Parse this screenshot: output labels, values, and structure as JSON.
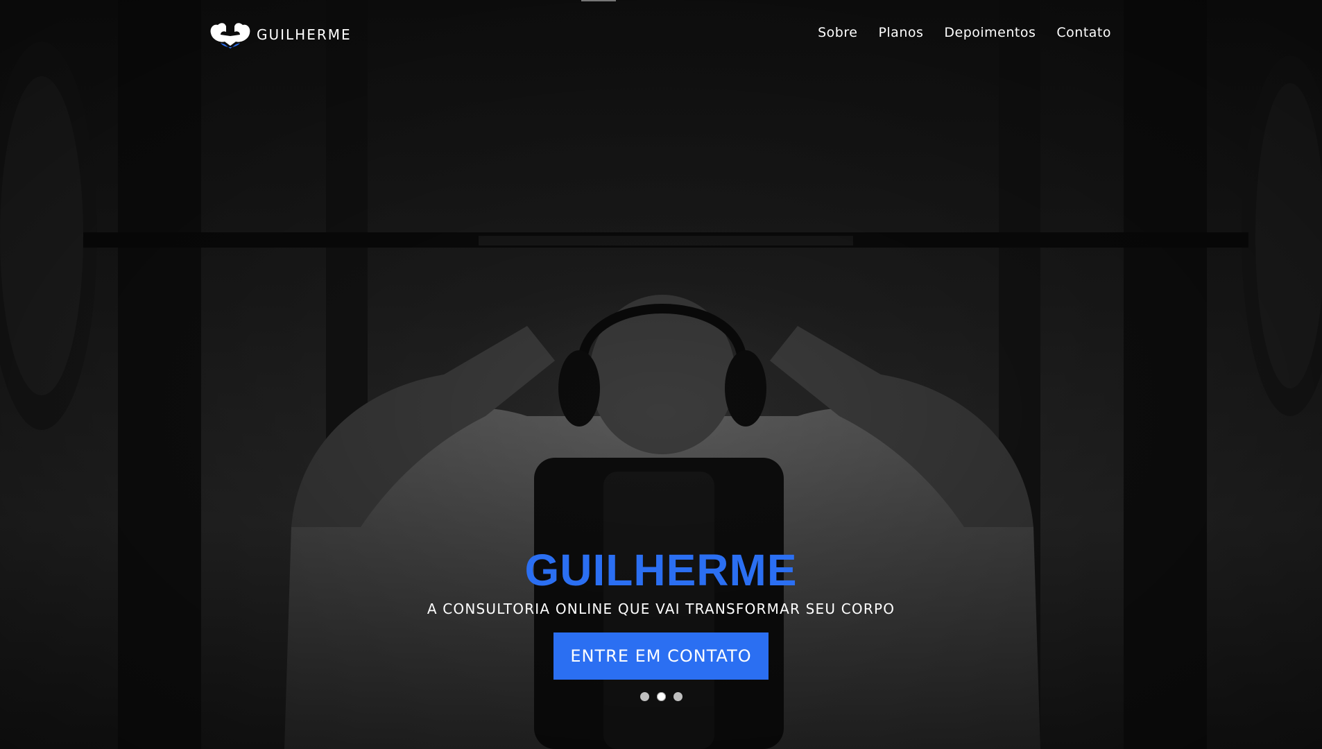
{
  "brand": {
    "name": "GUILHERME",
    "logo_icon": "flexing-arms-icon"
  },
  "nav": {
    "items": [
      {
        "label": "Sobre"
      },
      {
        "label": "Planos"
      },
      {
        "label": "Depoimentos"
      },
      {
        "label": "Contato"
      }
    ]
  },
  "hero": {
    "title": "GUILHERME",
    "subtitle": "A CONSULTORIA ONLINE QUE VAI TRANSFORMAR SEU CORPO",
    "cta_label": "ENTRE EM CONTATO",
    "slides_total": 3,
    "active_slide": 2
  },
  "colors": {
    "accent": "#2b6ff2",
    "text": "#ffffff",
    "background": "#1a1a1a"
  }
}
